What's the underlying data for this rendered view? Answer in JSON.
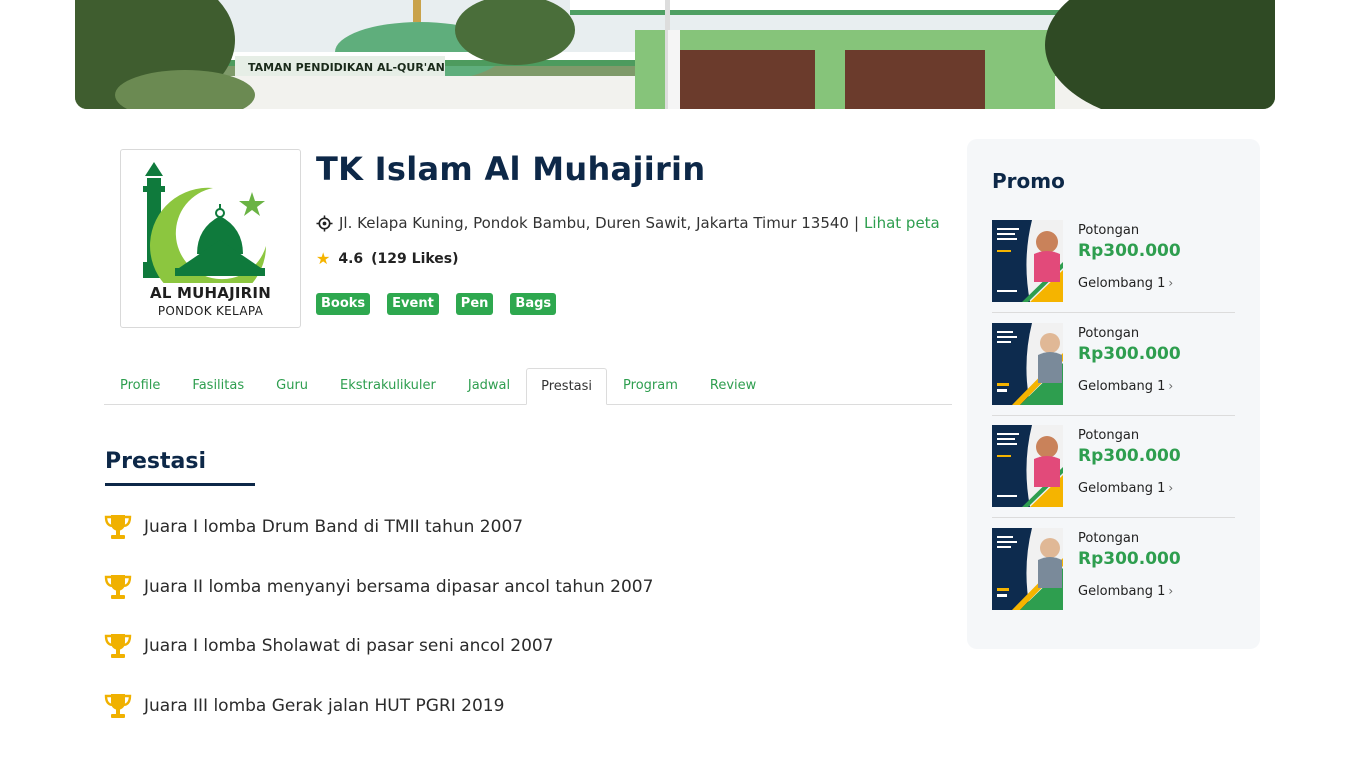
{
  "banner": {
    "sign_text": "TAMAN PENDIDIKAN AL-QUR'AN"
  },
  "school": {
    "logo": {
      "name": "AL MUHAJIRIN",
      "subtitle": "PONDOK KELAPA"
    },
    "title": "TK Islam Al Muhajirin",
    "address": "Jl. Kelapa Kuning, Pondok Bambu, Duren Sawit, Jakarta Timur 13540",
    "separator": "|",
    "map_link": "Lihat peta",
    "rating": "4.6",
    "likes": "(129 Likes)",
    "tags": [
      "Books",
      "Event",
      "Pen",
      "Bags"
    ]
  },
  "tabs": [
    {
      "label": "Profile",
      "active": false
    },
    {
      "label": "Fasilitas",
      "active": false
    },
    {
      "label": "Guru",
      "active": false
    },
    {
      "label": "Ekstrakulikuler",
      "active": false
    },
    {
      "label": "Jadwal",
      "active": false
    },
    {
      "label": "Prestasi",
      "active": true
    },
    {
      "label": "Program",
      "active": false
    },
    {
      "label": "Review",
      "active": false
    }
  ],
  "prestasi": {
    "title": "Prestasi",
    "items": [
      "Juara I lomba Drum Band di TMII tahun 2007",
      "Juara II lomba menyanyi bersama dipasar ancol tahun 2007",
      "Juara I lomba Sholawat di pasar seni ancol 2007",
      "Juara III lomba Gerak jalan HUT PGRI 2019"
    ]
  },
  "promo": {
    "title": "Promo",
    "items": [
      {
        "label": "Potongan",
        "price": "Rp300.000",
        "wave": "Gelombang 1",
        "thumb": "wordpress-author"
      },
      {
        "label": "Potongan",
        "price": "Rp300.000",
        "wave": "Gelombang 1",
        "thumb": "courses-45"
      },
      {
        "label": "Potongan",
        "price": "Rp300.000",
        "wave": "Gelombang 1",
        "thumb": "wordpress-author"
      },
      {
        "label": "Potongan",
        "price": "Rp300.000",
        "wave": "Gelombang 1",
        "thumb": "courses-45"
      }
    ]
  },
  "colors": {
    "navy": "#0d2848",
    "green": "#2e9e4f",
    "tag_green": "#2ea84f",
    "star": "#f5b400",
    "trophy": "#f0b100"
  },
  "icons": {
    "location": "location-target-icon",
    "rating": "star-icon",
    "achievement": "trophy-icon",
    "promo_more": "chevron-right-icon"
  }
}
